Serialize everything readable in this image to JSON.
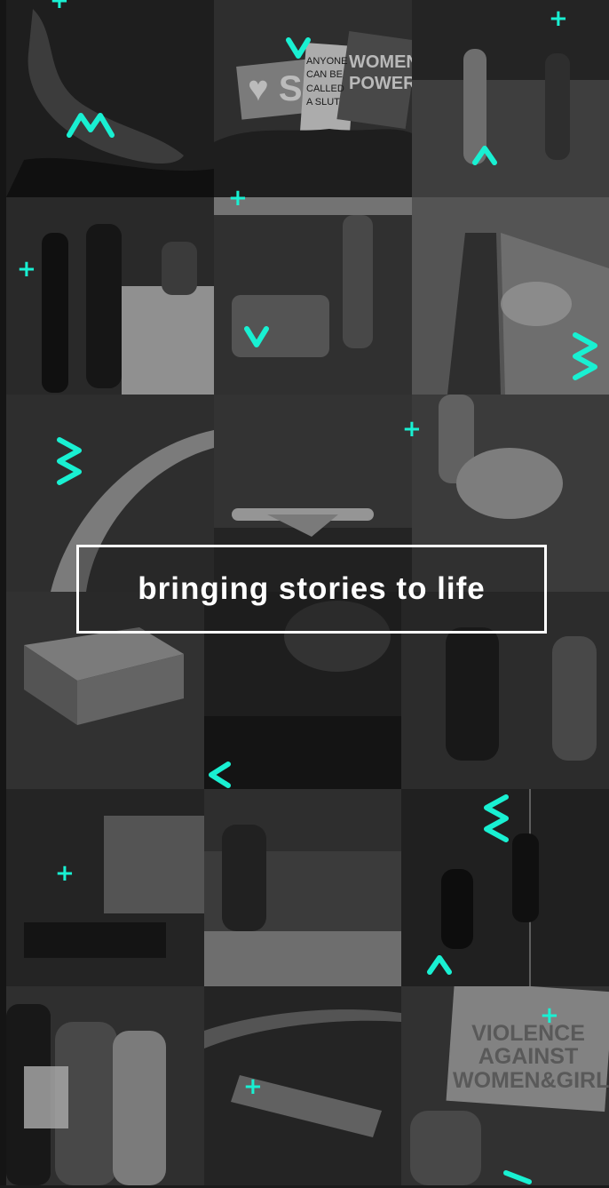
{
  "tagline": "bringing stories to life",
  "accent_color": "#19f0d2",
  "protest_signs": {
    "heart_sign": "♥ S",
    "handwritten_sign": "ANYONE CAN BE CALLED A SLUT",
    "power_sign": "WOMEN POWER",
    "violence_sign": "VIOLENCE AGAINST WOMEN&GIRLS"
  },
  "tiles": [
    {
      "name": "atoll-map-tile",
      "tone": "#2a2a2a"
    },
    {
      "name": "protest-signs-tile",
      "tone": "#3a3a3a"
    },
    {
      "name": "street-walkers-tile",
      "tone": "#4a4a4a"
    },
    {
      "name": "award-ceremony-tile",
      "tone": "#333333"
    },
    {
      "name": "airplane-cabin-tile",
      "tone": "#3c3c3c"
    },
    {
      "name": "runway-aerial-tile",
      "tone": "#474747"
    },
    {
      "name": "breakwater-tile",
      "tone": "#3a3a3a"
    },
    {
      "name": "airplane-takeoff-tile",
      "tone": "#3f3f3f"
    },
    {
      "name": "turtle-carry-tile",
      "tone": "#454545"
    },
    {
      "name": "underwater-sculpture-tile",
      "tone": "#3d3d3d"
    },
    {
      "name": "conference-audience-tile",
      "tone": "#2c2c2c"
    },
    {
      "name": "motorbike-street-tile",
      "tone": "#383838"
    },
    {
      "name": "resort-interior-tile",
      "tone": "#2e2e2e"
    },
    {
      "name": "people-on-ground-tile",
      "tone": "#444444"
    },
    {
      "name": "freediving-tile",
      "tone": "#2b2b2b"
    },
    {
      "name": "certificate-group-tile",
      "tone": "#3b3b3b"
    },
    {
      "name": "ship-aerial-tile",
      "tone": "#2f2f2f"
    },
    {
      "name": "violence-protest-tile",
      "tone": "#3e3e3e"
    }
  ],
  "icons": {
    "plus": "plus-icon",
    "chevron_up": "chevron-up-icon",
    "chevron_down": "chevron-down-icon",
    "chevron_left": "chevron-left-icon",
    "zigzag": "zigzag-icon",
    "m_mark": "m-mark-icon"
  }
}
